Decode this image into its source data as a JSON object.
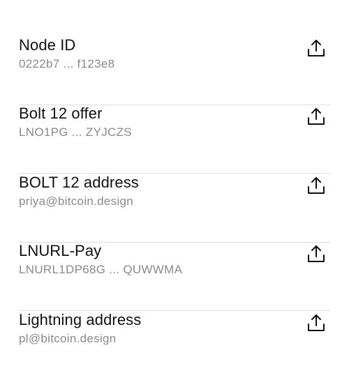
{
  "items": [
    {
      "title": "Node ID",
      "value": "0222b7 ... f123e8",
      "action_icon": "share-icon"
    },
    {
      "title": "Bolt 12 offer",
      "value": "LNO1PG ... ZYJCZS",
      "action_icon": "share-icon"
    },
    {
      "title": "BOLT 12 address",
      "value": "priya@bitcoin.design",
      "action_icon": "share-icon"
    },
    {
      "title": "LNURL-Pay",
      "value": "LNURL1DP68G ... QUWWMA",
      "action_icon": "share-icon"
    },
    {
      "title": "Lightning address",
      "value": "pl@bitcoin.design",
      "action_icon": "share-icon"
    }
  ],
  "colors": {
    "title": "#111111",
    "subtitle": "#8a8a8a",
    "divider": "#dcdcdc",
    "icon": "#111111"
  }
}
